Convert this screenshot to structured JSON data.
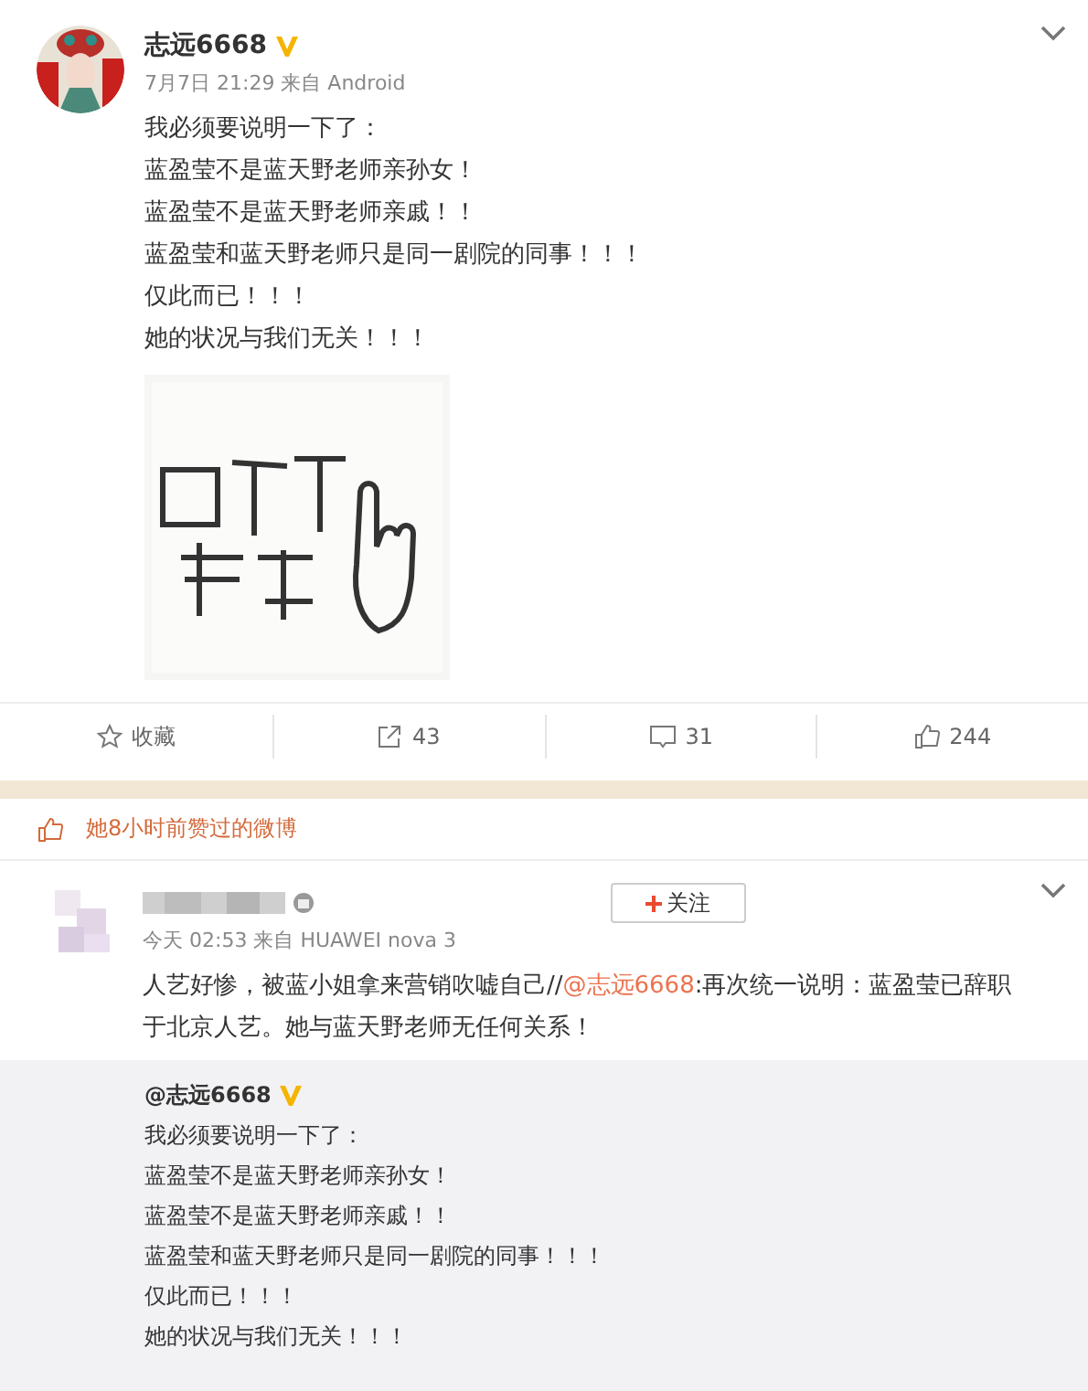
{
  "post": {
    "author": "志远6668",
    "verified": true,
    "meta": "7月7日 21:29 来自 Android",
    "lines": [
      "我必须要说明一下了：",
      "蓝盈莹不是蓝天野老师亲孙女！",
      "蓝盈莹不是蓝天野老师亲戚！！",
      "蓝盈莹和蓝天野老师只是同一剧院的同事！！！",
      "仅此而已！！！",
      "她的状况与我们无关！！！"
    ],
    "actions": [
      {
        "kind": "favorite",
        "label": "收藏"
      },
      {
        "kind": "repost",
        "label": "43"
      },
      {
        "kind": "comment",
        "label": "31"
      },
      {
        "kind": "like",
        "label": "244"
      }
    ]
  },
  "liked_notice": "她8小时前赞过的微博",
  "repost": {
    "meta": "今天 02:53 来自 HUAWEI nova 3",
    "follow_button": "关注",
    "text_before": "人艺好惨，被蓝小姐拿来营销吹嘘自己//",
    "mention": "@志远6668",
    "text_after": ":再次统一说明：蓝盈莹已辞职于北京人艺。她与蓝天野老师无任何关系！",
    "quoted": {
      "author": "@志远6668",
      "verified": true,
      "lines": [
        "我必须要说明一下了：",
        "蓝盈莹不是蓝天野老师亲孙女！",
        "蓝盈莹不是蓝天野老师亲戚！！",
        "蓝盈莹和蓝天野老师只是同一剧院的同事！！！",
        "仅此而已！！！",
        "她的状况与我们无关！！！"
      ]
    }
  }
}
